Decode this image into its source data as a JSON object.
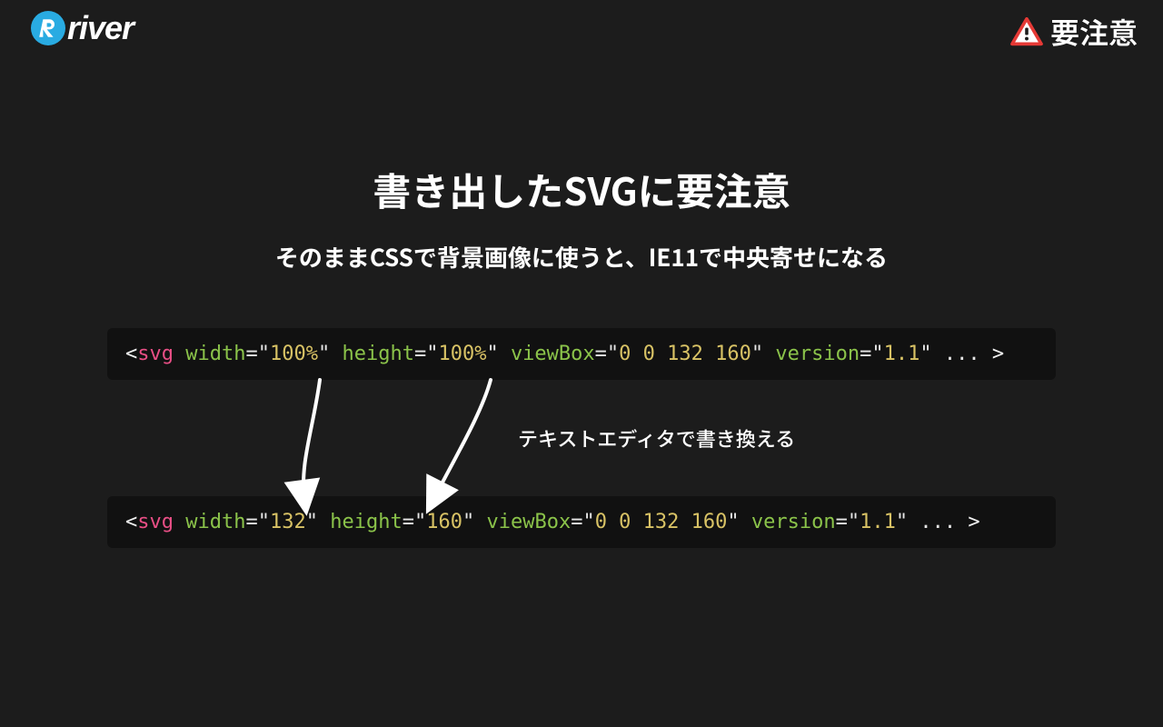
{
  "header": {
    "logo_text": "river",
    "warning_label": "要注意"
  },
  "slide": {
    "title": "書き出したSVGに要注意",
    "subtitle": "そのままCSSで背景画像に使うと、IE11で中央寄せになる",
    "annotation": "テキストエディタで書き換える"
  },
  "code": {
    "before": {
      "open": "<",
      "tag": "svg",
      "attrs": [
        {
          "name": "width",
          "value": "100%"
        },
        {
          "name": "height",
          "value": "100%"
        },
        {
          "name": "viewBox",
          "value": "0 0 132 160"
        },
        {
          "name": "version",
          "value": "1.1"
        }
      ],
      "trail": " ... ",
      "close": ">"
    },
    "after": {
      "open": "<",
      "tag": "svg",
      "attrs": [
        {
          "name": "width",
          "value": "132"
        },
        {
          "name": "height",
          "value": "160"
        },
        {
          "name": "viewBox",
          "value": "0 0 132 160"
        },
        {
          "name": "version",
          "value": "1.1"
        }
      ],
      "trail": " ... ",
      "close": ">"
    }
  },
  "colors": {
    "bg": "#1c1c1c",
    "code_bg": "#111111",
    "tag": "#e94f86",
    "attr": "#8bc34a",
    "val": "#d8c265",
    "accent": "#29abe2",
    "warn": "#e53935"
  }
}
